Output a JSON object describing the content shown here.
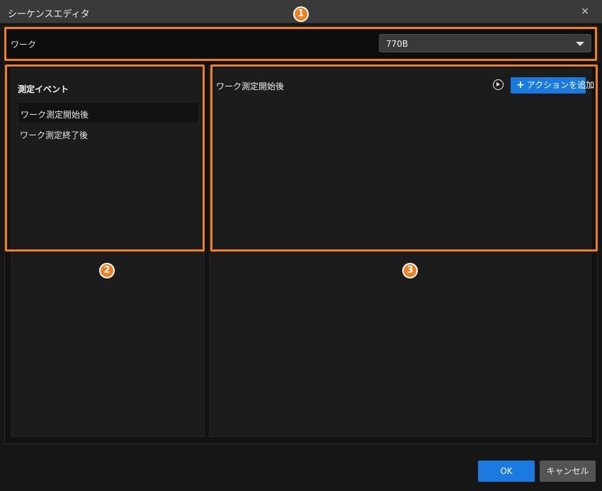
{
  "window": {
    "title": "シーケンスエディタ",
    "close_glyph": "×"
  },
  "work": {
    "label": "ワーク",
    "selected": "770B"
  },
  "events": {
    "heading": "測定イベント",
    "items": [
      {
        "label": "ワーク測定開始後",
        "selected": true
      },
      {
        "label": "ワーク測定終了後",
        "selected": false
      }
    ]
  },
  "actions": {
    "heading": "ワーク測定開始後",
    "add_label": "アクションを追加",
    "add_plus": "+"
  },
  "footer": {
    "ok_label": "OK",
    "cancel_label": "キャンセル"
  },
  "annotations": {
    "badge1": "1",
    "badge2": "2",
    "badge3": "3",
    "color": "#f07f1f"
  },
  "colors": {
    "accent": "#1a7ae0",
    "highlight": "#f07f1f"
  }
}
